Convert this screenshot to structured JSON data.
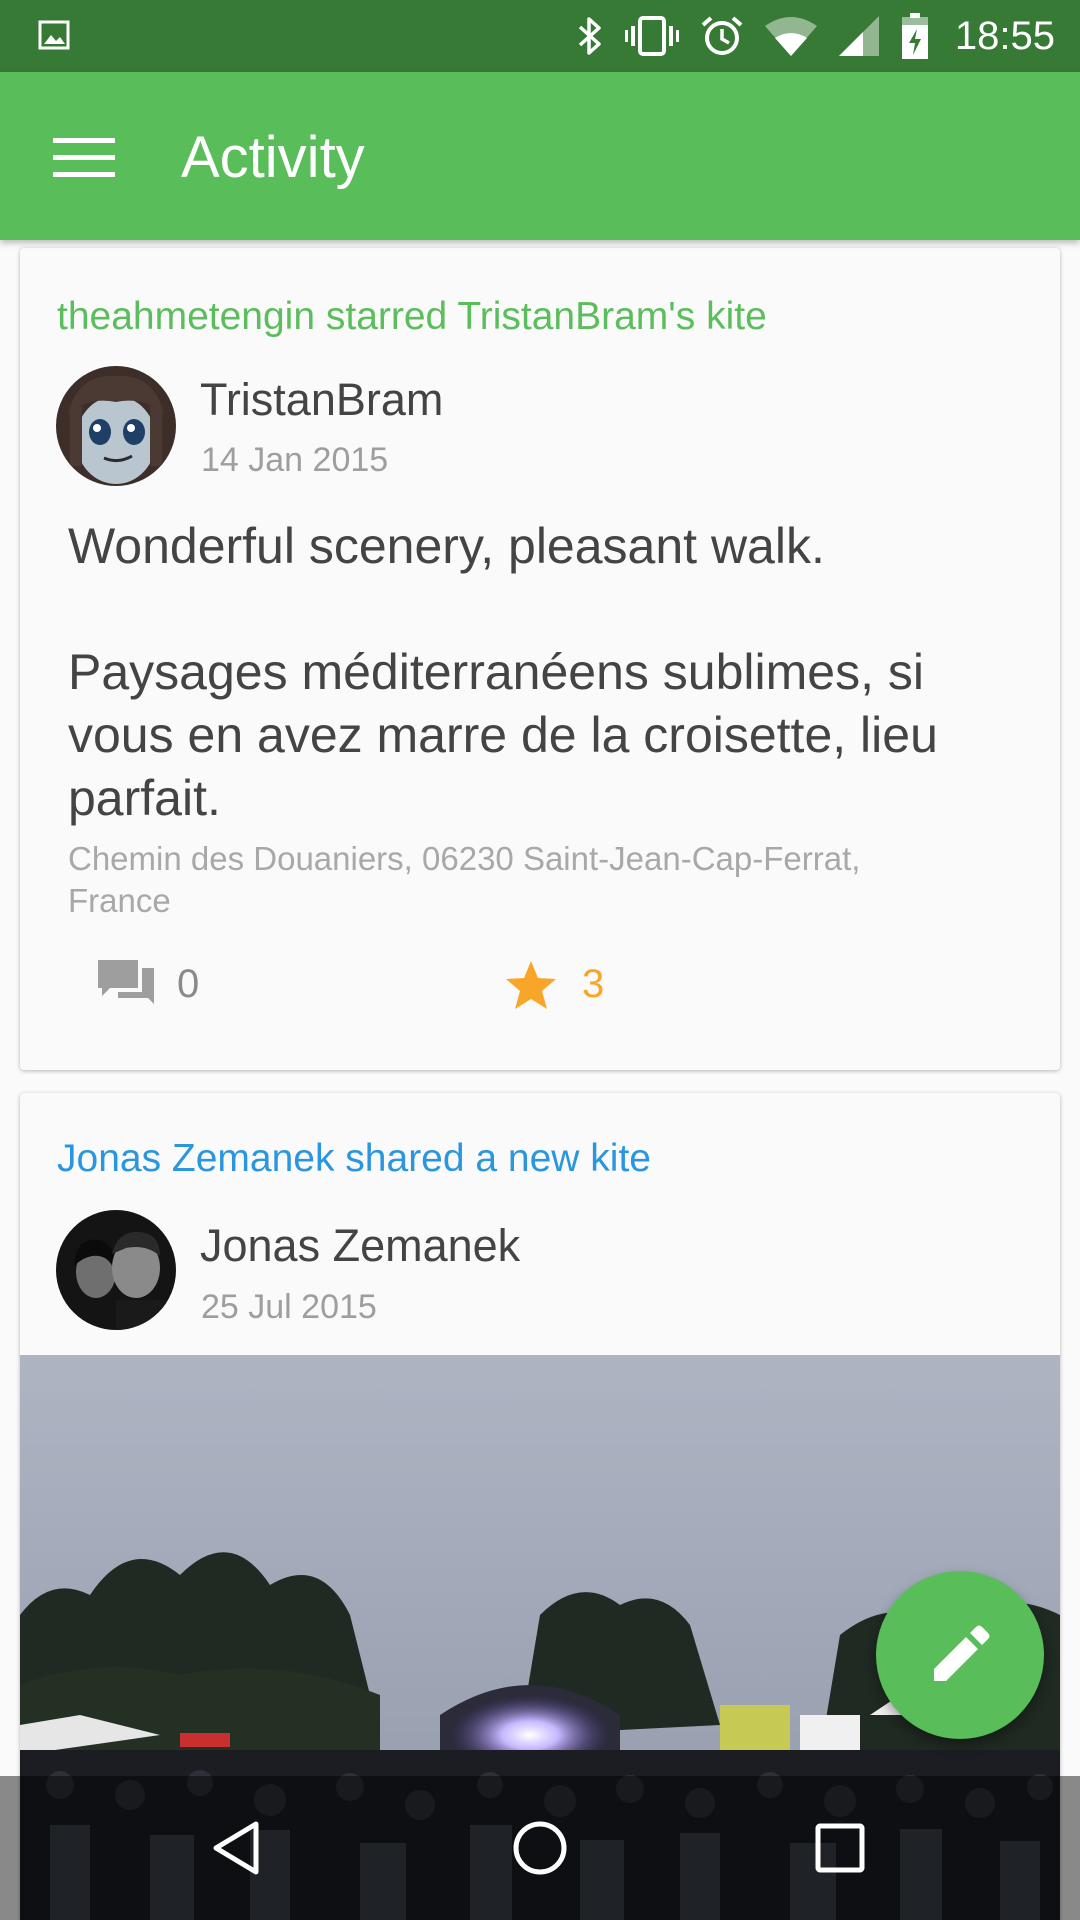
{
  "status_bar": {
    "time": "18:55",
    "color": "#377a36",
    "icons": [
      "image-icon",
      "bluetooth-icon",
      "vibrate-icon",
      "alarm-icon",
      "wifi-icon",
      "signal-icon",
      "battery-charging-icon"
    ]
  },
  "app_bar": {
    "title": "Activity",
    "color": "#59bd59"
  },
  "feed": [
    {
      "activity": "theahmetengin starred TristanBram's kite",
      "user": "TristanBram",
      "date": "14 Jan 2015",
      "text": "Wonderful scenery, pleasant walk.\n\nPaysages méditerranéens sublimes, si vous en avez marre de la croisette, lieu parfait.",
      "location": "Chemin des Douaniers, 06230 Saint-Jean-Cap-Ferrat, France",
      "comments": "0",
      "stars": "3"
    },
    {
      "activity": "Jonas Zemanek shared a new kite",
      "user": "Jonas Zemanek",
      "date": "25 Jul 2015",
      "image": "concert-photo"
    }
  ],
  "fab": {
    "icon": "pencil-icon"
  },
  "nav_bar": {
    "icons": [
      "back-icon",
      "home-icon",
      "recents-icon"
    ]
  }
}
